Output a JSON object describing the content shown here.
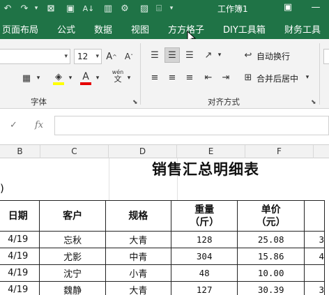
{
  "window": {
    "title": "工作簿1"
  },
  "tabs": [
    "页面布局",
    "公式",
    "数据",
    "视图",
    "方方格子",
    "DIY工具箱",
    "财务工具"
  ],
  "ribbon": {
    "font_size": "12",
    "wrap_text_label": "自动换行",
    "merge_center_label": "合并后居中",
    "font_group_label": "字体",
    "align_group_label": "对齐方式",
    "wen_label": "wén",
    "wen_char": "文",
    "font_letter": "A",
    "grow_font_letter": "A",
    "shrink_font_letter": "A",
    "colors": {
      "highlight": "#ffff00",
      "font": "#e60000"
    }
  },
  "formula_bar": {
    "fx_label": "fx",
    "cancel_icon": "✓",
    "value": ""
  },
  "columns": [
    "B",
    "C",
    "D",
    "E",
    "F"
  ],
  "sheet": {
    "title": "销售汇总明细表",
    "paren_text": ")",
    "headers": [
      {
        "line1": "日期",
        "line2": ""
      },
      {
        "line1": "客户",
        "line2": ""
      },
      {
        "line1": "规格",
        "line2": ""
      },
      {
        "line1": "重量",
        "line2": "（斤）"
      },
      {
        "line1": "单价",
        "line2": "（元）"
      }
    ],
    "rows": [
      {
        "date": "4/19",
        "customer": "忘秋",
        "spec": "大青",
        "weight": "128",
        "price": "25.08",
        "extra": "3"
      },
      {
        "date": "4/19",
        "customer": "尤影",
        "spec": "中青",
        "weight": "304",
        "price": "15.86",
        "extra": "4"
      },
      {
        "date": "4/19",
        "customer": "沈宁",
        "spec": "小青",
        "weight": "48",
        "price": "10.00",
        "extra": ""
      },
      {
        "date": "4/19",
        "customer": "魏静",
        "spec": "大青",
        "weight": "127",
        "price": "30.39",
        "extra": "3"
      }
    ]
  }
}
